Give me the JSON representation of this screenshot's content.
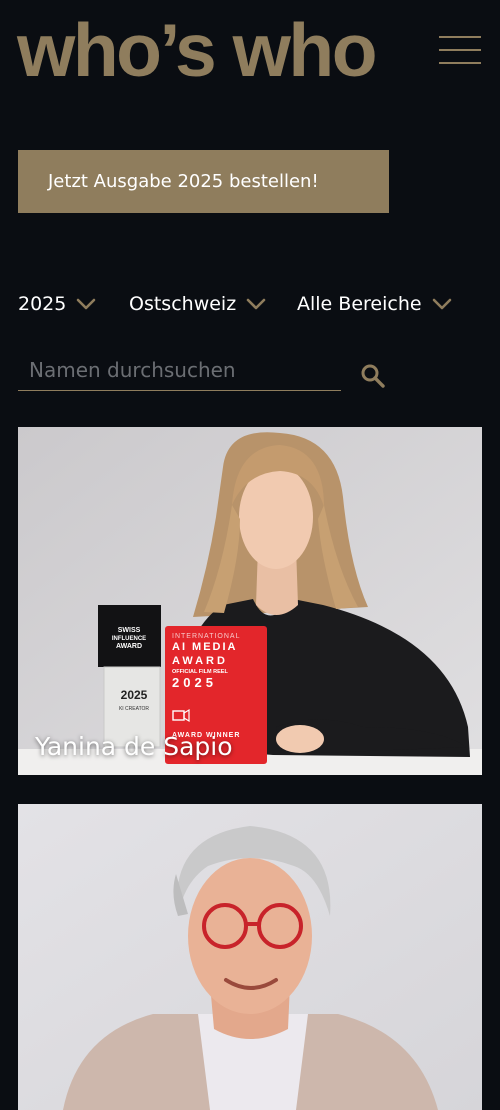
{
  "brand": {
    "logo_text": "who’s who",
    "color": "#8f7d5d"
  },
  "header": {
    "menu_icon": "hamburger-icon"
  },
  "cta": {
    "label": "Jetzt Ausgabe 2025 bestellen!"
  },
  "filters": [
    {
      "value": "2025"
    },
    {
      "value": "Ostschweiz"
    },
    {
      "value": "Alle Bereiche"
    }
  ],
  "search": {
    "placeholder": "Namen durchsuchen",
    "value": "",
    "icon": "search-icon"
  },
  "profiles": [
    {
      "name": "Yanina de Sapio",
      "trophy": {
        "line1": "SWISS",
        "line2": "INFLUENCE",
        "line3": "AWARD",
        "year": "2025",
        "category": "KI CREATOR"
      },
      "award": {
        "top": "INTERNATIONAL",
        "line1": "AI MEDIA",
        "line2": "AWARD",
        "line3": "OFFICIAL FILM REEL",
        "year": "2025",
        "bottom": "AWARD WINNER"
      }
    },
    {
      "name": ""
    }
  ]
}
